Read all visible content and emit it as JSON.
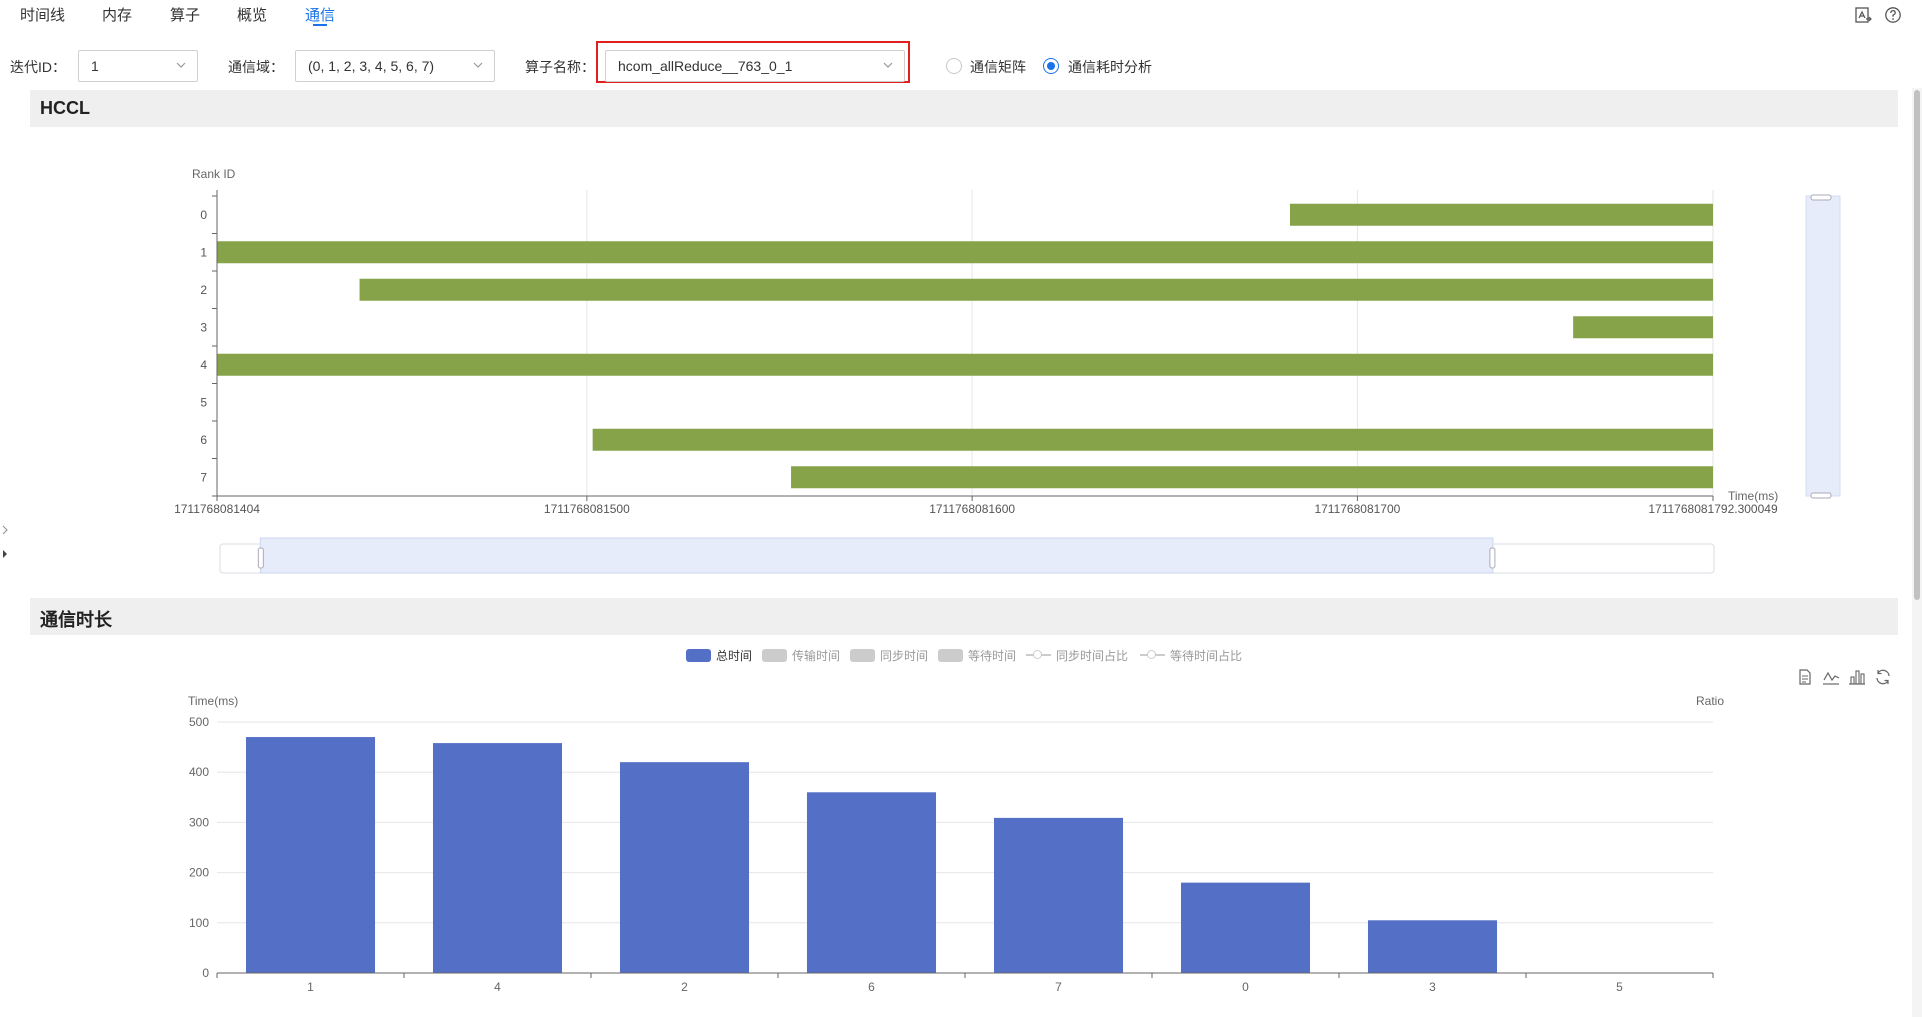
{
  "tabs": [
    {
      "label": "时间线",
      "active": false
    },
    {
      "label": "内存",
      "active": false
    },
    {
      "label": "算子",
      "active": false
    },
    {
      "label": "概览",
      "active": false
    },
    {
      "label": "通信",
      "active": true
    }
  ],
  "filters": {
    "iteration_label": "迭代ID：",
    "iteration_value": "1",
    "domain_label": "通信域：",
    "domain_value": "(0, 1, 2, 3, 4, 5, 6, 7)",
    "operator_label": "算子名称：",
    "operator_value": "hcom_allReduce__763_0_1",
    "radio_matrix": "通信矩阵",
    "radio_duration": "通信耗时分析",
    "selected_radio": "radio_duration"
  },
  "sections": {
    "hccl_title": "HCCL",
    "duration_title": "通信时长"
  },
  "colors": {
    "accent": "#1a73e8",
    "gantt_bar": "#86a34a",
    "duration_bar": "#5470c6",
    "highlight": "#e02020"
  },
  "hccl_chart": {
    "type": "gantt",
    "y_axis_name": "Rank ID",
    "x_axis_name": "Time(ms)",
    "x_min": 1711768081404,
    "x_max": 1711768081792.3,
    "x_tick_labels": [
      "1711768081404",
      "1711768081500",
      "1711768081600",
      "1711768081700",
      "1711768081792.300049"
    ],
    "x_tick_values": [
      1711768081404,
      1711768081500,
      1711768081600,
      1711768081700,
      1711768081792.3
    ],
    "ranks": [
      "0",
      "1",
      "2",
      "3",
      "4",
      "5",
      "6",
      "7"
    ],
    "bars": [
      {
        "rank": "0",
        "start": 1711768081682.5,
        "end": 1711768081792.3
      },
      {
        "rank": "1",
        "start": 1711768081404,
        "end": 1711768081792.3
      },
      {
        "rank": "2",
        "start": 1711768081441,
        "end": 1711768081792.3
      },
      {
        "rank": "3",
        "start": 1711768081756,
        "end": 1711768081792.3
      },
      {
        "rank": "4",
        "start": 1711768081404,
        "end": 1711768081792.3
      },
      {
        "rank": "6",
        "start": 1711768081501.5,
        "end": 1711768081792.3
      },
      {
        "rank": "7",
        "start": 1711768081553,
        "end": 1711768081792.3
      }
    ],
    "zoom_x": [
      0.027,
      0.852
    ],
    "zoom_y": [
      0,
      1
    ]
  },
  "legend": [
    {
      "label": "总时间",
      "kind": "swatch",
      "color": "#5470c6",
      "active": true
    },
    {
      "label": "传输时间",
      "kind": "swatch",
      "color": "#cccccc",
      "active": false
    },
    {
      "label": "同步时间",
      "kind": "swatch",
      "color": "#cccccc",
      "active": false
    },
    {
      "label": "等待时间",
      "kind": "swatch",
      "color": "#cccccc",
      "active": false
    },
    {
      "label": "同步时间占比",
      "kind": "line",
      "color": "#cccccc",
      "active": false
    },
    {
      "label": "等待时间占比",
      "kind": "line",
      "color": "#cccccc",
      "active": false
    }
  ],
  "toolbox": [
    "data-view-icon",
    "line-chart-icon",
    "bar-chart-icon",
    "restore-icon"
  ],
  "chart_data": {
    "type": "bar",
    "ylabel": "Time(ms)",
    "y2label": "Ratio",
    "ylim": [
      0,
      500
    ],
    "y_ticks": [
      "0",
      "100",
      "200",
      "300",
      "400",
      "500"
    ],
    "categories": [
      "1",
      "4",
      "2",
      "6",
      "7",
      "0",
      "3",
      "5"
    ],
    "series": [
      {
        "name": "总时间",
        "values": [
          470,
          458,
          420,
          360,
          309,
          180,
          105,
          0
        ]
      }
    ],
    "grid": true,
    "legend_position": "top-center"
  }
}
